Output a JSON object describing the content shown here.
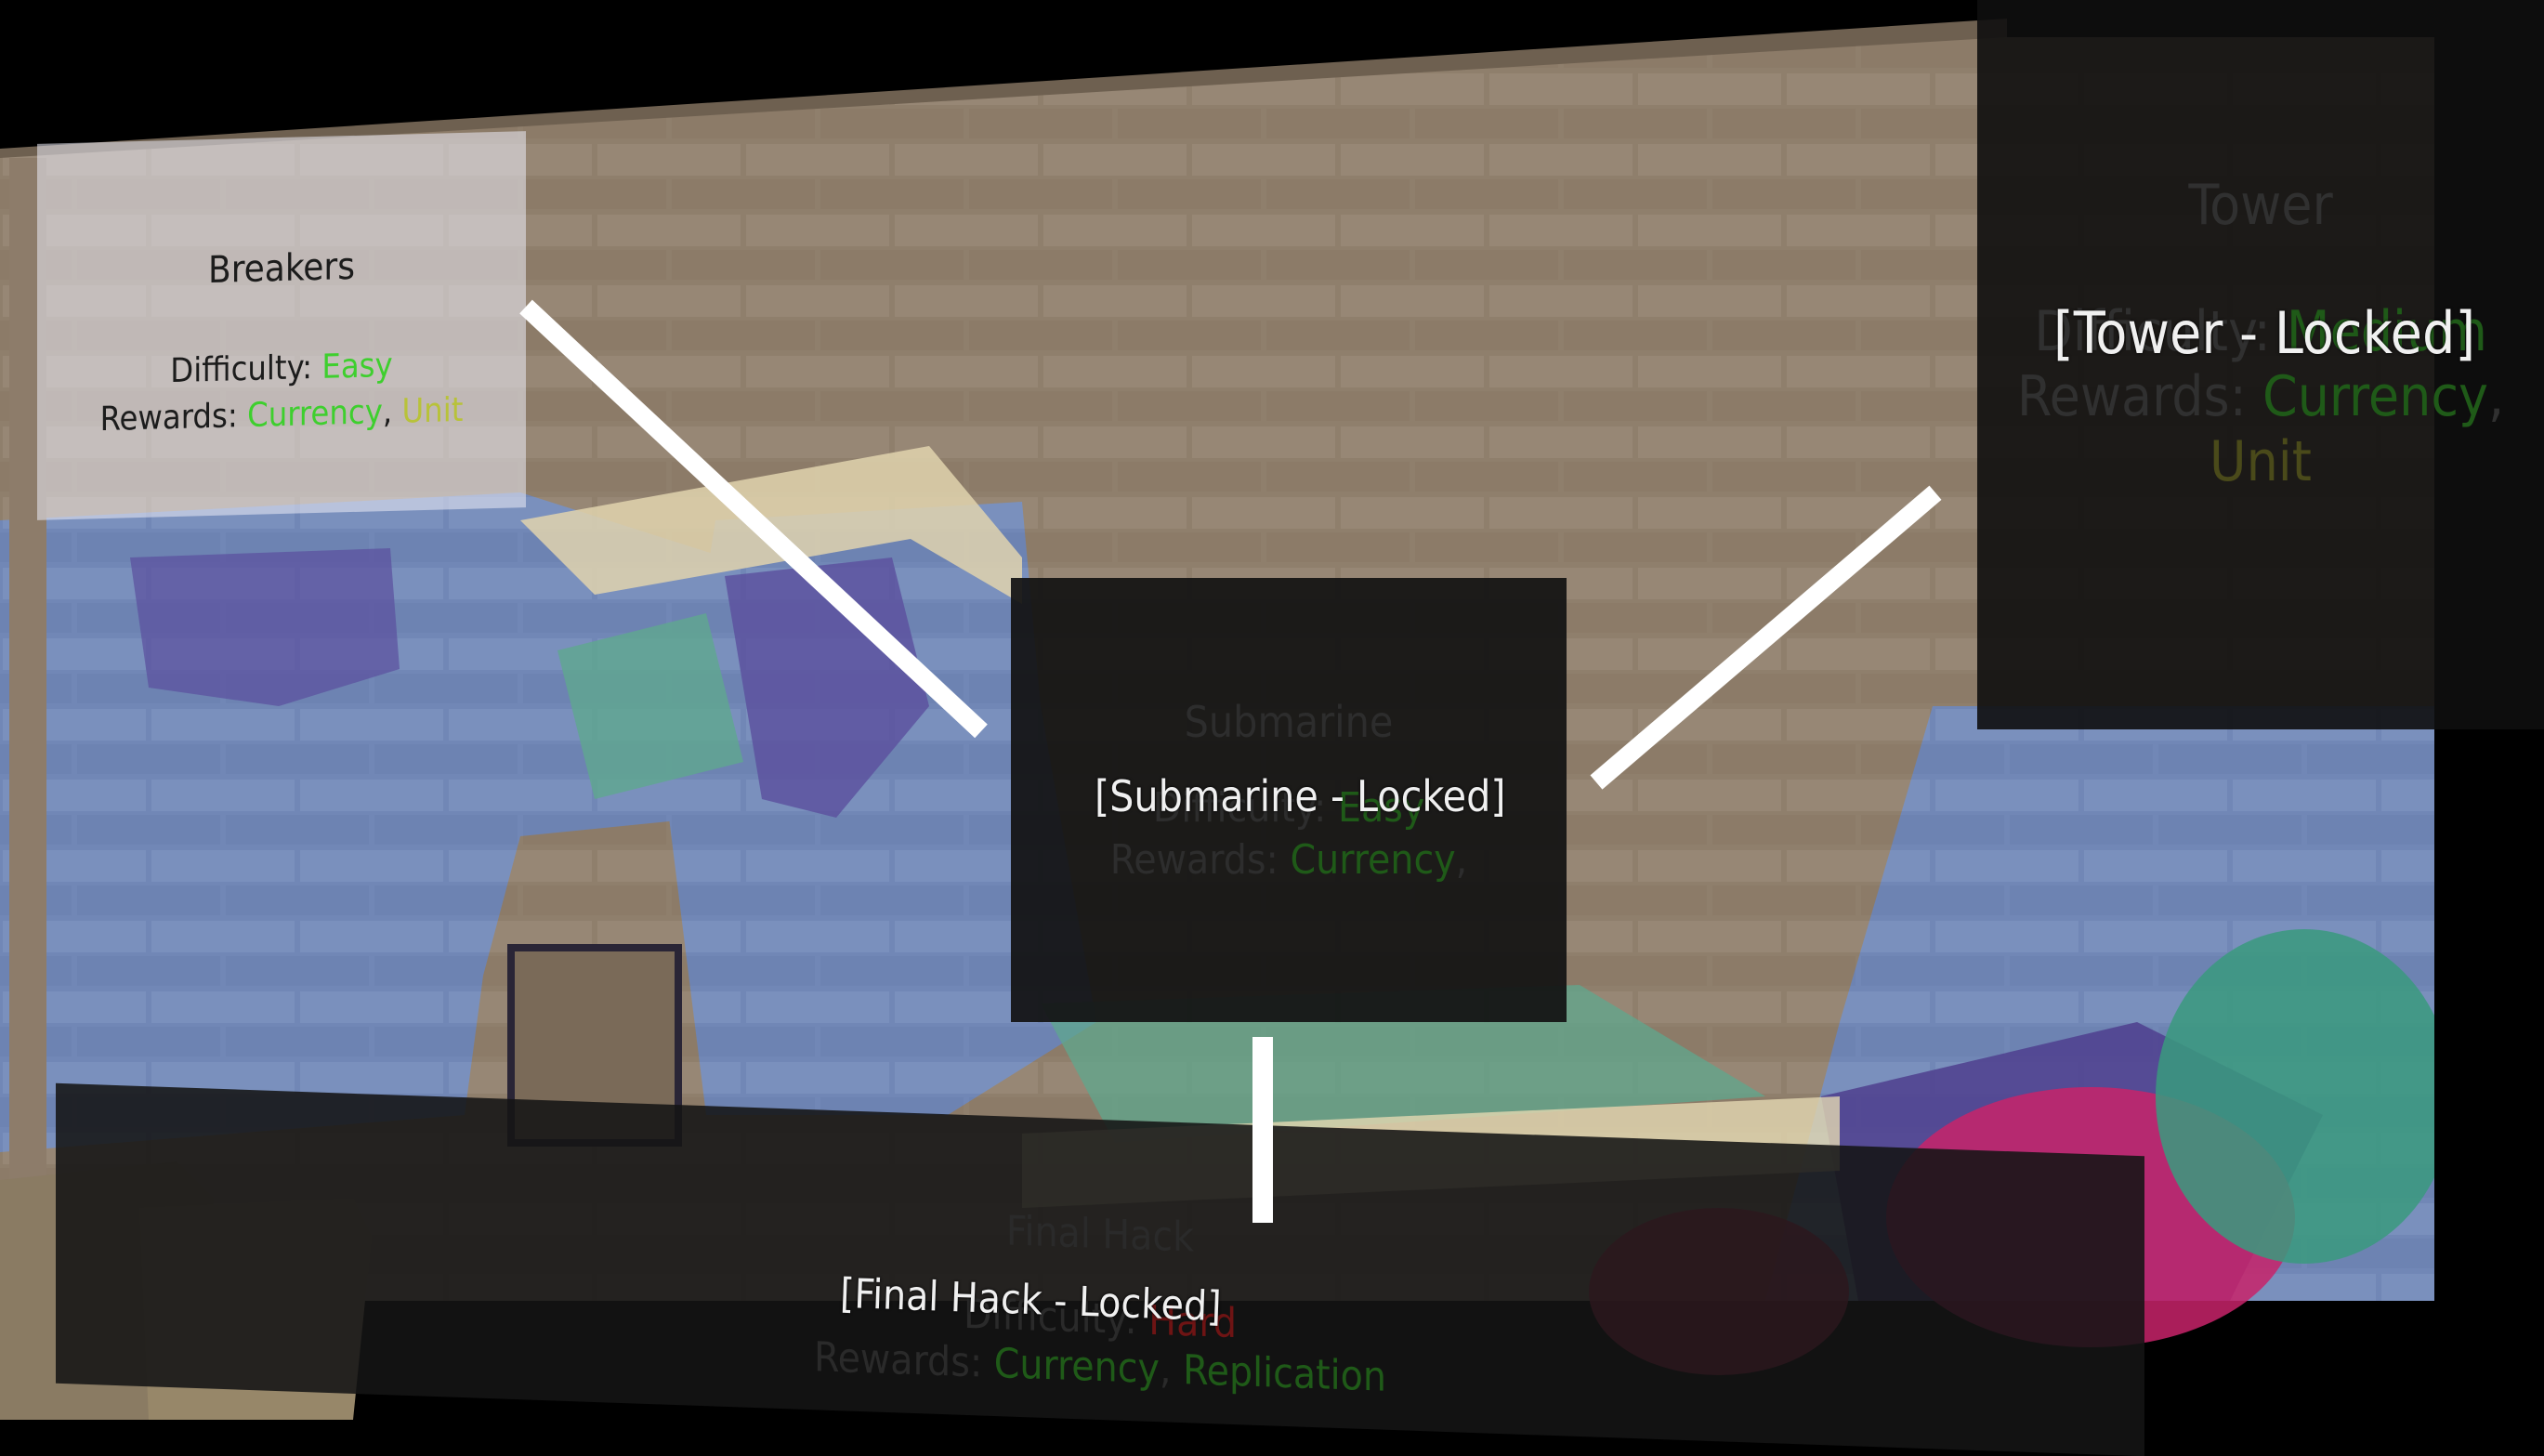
{
  "colors": {
    "brick": "#8a7a67",
    "mural_blue": "#6e86b5",
    "mural_purple": "#5b4f9e",
    "mural_teal": "#5fa78e",
    "mural_cream": "#e4d8b2",
    "panel_dark": "#121212",
    "difficulty_easy": "#3ecf2e",
    "reward_currency": "#3ecf2e",
    "reward_unit": "#b8c23a",
    "difficulty_hard": "#6e1414"
  },
  "levels": {
    "breakers": {
      "title": "Breakers",
      "difficulty_label": "Difficulty:",
      "difficulty_value": "Easy",
      "rewards_label": "Rewards:",
      "reward_1": "Currency",
      "reward_sep": ",",
      "reward_2": "Unit"
    },
    "submarine": {
      "title": "Submarine",
      "locked_label": "[Submarine - Locked]",
      "difficulty_label": "Difficulty:",
      "difficulty_value": "Easy",
      "rewards_label": "Rewards:",
      "reward_1": "Currency",
      "reward_sep": ","
    },
    "tower": {
      "title": "Tower",
      "locked_label": "[Tower - Locked]",
      "difficulty_label": "Difficulty:",
      "difficulty_value": "Medium",
      "rewards_label": "Rewards:",
      "reward_1": "Currency",
      "reward_sep": ",",
      "reward_2": "Unit"
    },
    "final_hack": {
      "title": "Final Hack",
      "locked_label": "[Final Hack - Locked]",
      "difficulty_label": "Difficulty:",
      "difficulty_value": "Hard",
      "rewards_label": "Rewards:",
      "reward_1": "Currency",
      "reward_sep": ",",
      "reward_2": "Replication"
    }
  }
}
